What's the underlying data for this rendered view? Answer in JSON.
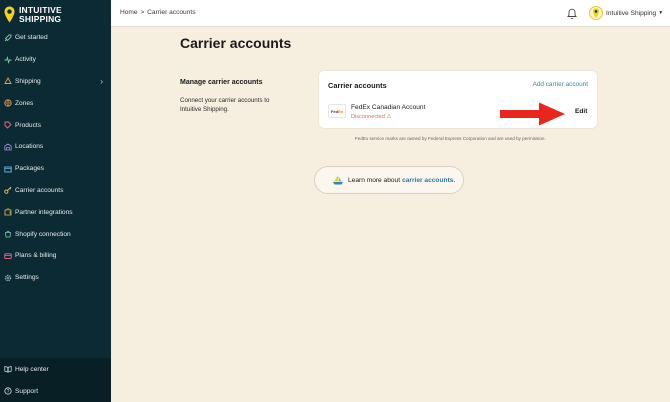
{
  "app": {
    "name": "INTUITIVE SHIPPING",
    "name_line1": "INTUITIVE",
    "name_line2": "SHIPPING"
  },
  "sidebar": {
    "items": [
      {
        "label": "Get started",
        "icon": "rocket-icon"
      },
      {
        "label": "Activity",
        "icon": "activity-icon"
      },
      {
        "label": "Shipping",
        "icon": "shipping-icon",
        "has_submenu": true
      },
      {
        "label": "Zones",
        "icon": "globe-icon"
      },
      {
        "label": "Products",
        "icon": "tag-icon"
      },
      {
        "label": "Locations",
        "icon": "warehouse-icon"
      },
      {
        "label": "Packages",
        "icon": "package-icon"
      },
      {
        "label": "Carrier accounts",
        "icon": "key-icon"
      },
      {
        "label": "Partner integrations",
        "icon": "puzzle-icon"
      },
      {
        "label": "Shopify connection",
        "icon": "shopify-icon"
      },
      {
        "label": "Plans & billing",
        "icon": "billing-icon"
      },
      {
        "label": "Settings",
        "icon": "gear-icon"
      }
    ],
    "footer": [
      {
        "label": "Help center",
        "icon": "book-icon"
      },
      {
        "label": "Support",
        "icon": "help-icon"
      }
    ]
  },
  "header": {
    "breadcrumb": {
      "home": "Home",
      "separator": ">",
      "current": "Carrier accounts"
    },
    "user": "Intuitive Shipping"
  },
  "main": {
    "title": "Carrier accounts",
    "section": {
      "title": "Manage carrier accounts",
      "description": "Connect your carrier accounts to Intuitive Shipping."
    },
    "card": {
      "title": "Carrier accounts",
      "add_link": "Add carrier account",
      "account": {
        "logo_fe": "Fed",
        "logo_ex": "Ex",
        "name": "FedEx Canadian Account",
        "status": "Disconnected ⚠",
        "edit_label": "Edit"
      }
    },
    "trademark": "FedEx service marks are owned by Federal Express Corporation and are used by permission.",
    "learn_more": {
      "prefix": "Learn more about",
      "link": "carrier accounts."
    }
  },
  "colors": {
    "sidebar_bg": "#0c2a33",
    "page_bg": "#f6efe0",
    "accent_link": "#3b86a8",
    "logo_yellow": "#f4d21c",
    "status_red": "#e06a5a",
    "arrow_red": "#e8261d"
  }
}
